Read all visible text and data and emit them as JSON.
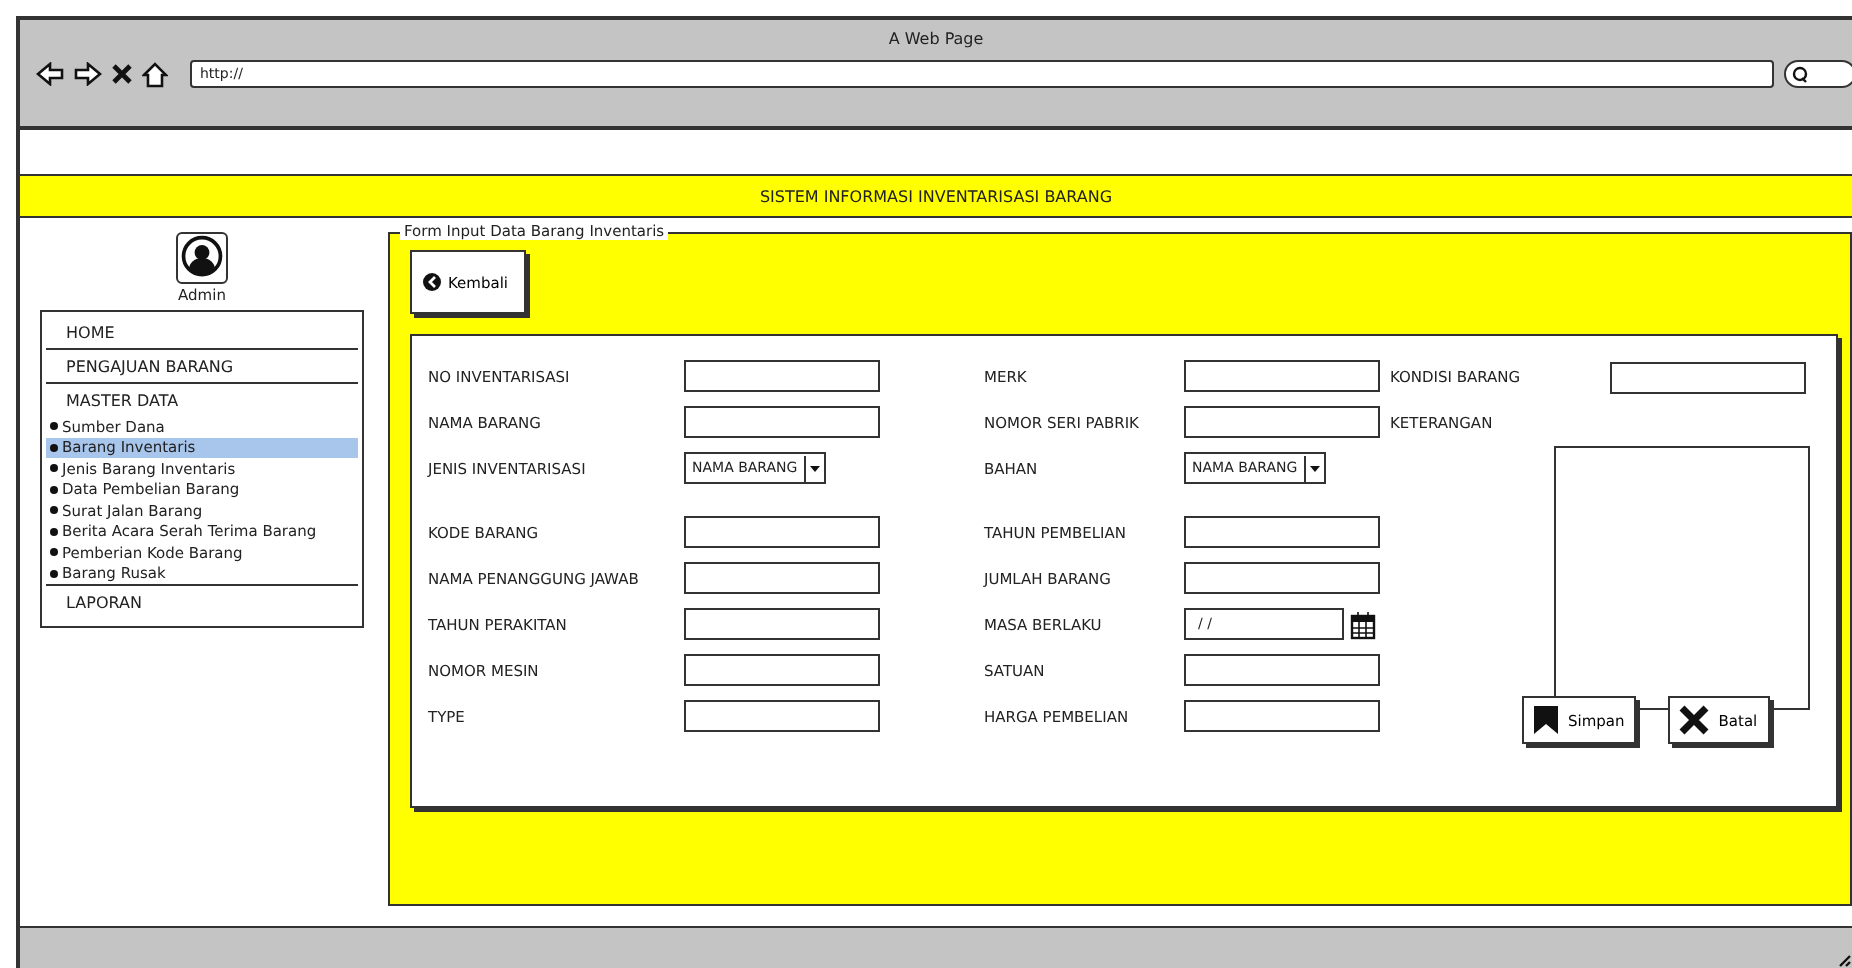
{
  "browser": {
    "title": "A Web Page",
    "url": "http://"
  },
  "header": {
    "title": "SISTEM INFORMASI INVENTARISASI BARANG"
  },
  "sidebar": {
    "user": "Admin",
    "menu": [
      {
        "label": "HOME",
        "kind": "section",
        "selected": false
      },
      {
        "label": "PENGAJUAN BARANG",
        "kind": "section",
        "selected": false
      },
      {
        "label": "MASTER DATA",
        "kind": "section",
        "selected": false
      },
      {
        "label": "Sumber Dana",
        "kind": "sub",
        "selected": false
      },
      {
        "label": "Barang Inventaris",
        "kind": "sub",
        "selected": true
      },
      {
        "label": "Jenis Barang Inventaris",
        "kind": "sub",
        "selected": false
      },
      {
        "label": "Data Pembelian Barang",
        "kind": "sub",
        "selected": false
      },
      {
        "label": "Surat Jalan Barang",
        "kind": "sub",
        "selected": false
      },
      {
        "label": "Berita Acara Serah Terima Barang",
        "kind": "sub",
        "selected": false
      },
      {
        "label": "Pemberian Kode Barang",
        "kind": "sub",
        "selected": false
      },
      {
        "label": "Barang Rusak",
        "kind": "sub",
        "selected": false
      },
      {
        "label": "LAPORAN",
        "kind": "section",
        "selected": false
      }
    ]
  },
  "form": {
    "legend": "Form Input Data Barang Inventaris",
    "back_button": "Kembali",
    "columns": [
      {
        "groups": [
          [
            {
              "label": "NO INVENTARISASI",
              "kind": "text"
            },
            {
              "label": "NAMA BARANG",
              "kind": "text"
            },
            {
              "label": "JENIS INVENTARISASI",
              "kind": "dropdown",
              "value": "NAMA BARANG"
            }
          ],
          [
            {
              "label": "KODE BARANG",
              "kind": "text"
            },
            {
              "label": "NAMA PENANGGUNG JAWAB",
              "kind": "text"
            },
            {
              "label": "TAHUN PERAKITAN",
              "kind": "text"
            },
            {
              "label": "NOMOR MESIN",
              "kind": "text"
            },
            {
              "label": "TYPE",
              "kind": "text"
            }
          ]
        ]
      },
      {
        "groups": [
          [
            {
              "label": "MERK",
              "kind": "text"
            },
            {
              "label": "NOMOR SERI PABRIK",
              "kind": "text"
            },
            {
              "label": "BAHAN",
              "kind": "dropdown",
              "value": "NAMA BARANG"
            }
          ],
          [
            {
              "label": "TAHUN PEMBELIAN",
              "kind": "text"
            },
            {
              "label": "JUMLAH BARANG",
              "kind": "text"
            },
            {
              "label": "MASA BERLAKU",
              "kind": "date",
              "value": "/ /"
            },
            {
              "label": "SATUAN",
              "kind": "text"
            },
            {
              "label": "HARGA PEMBELIAN",
              "kind": "text"
            }
          ]
        ]
      },
      {
        "groups": [
          [
            {
              "label": "KONDISI BARANG",
              "kind": "text"
            },
            {
              "label": "KETERANGAN",
              "kind": "textarea"
            }
          ]
        ]
      }
    ],
    "buttons": [
      {
        "label": "Simpan",
        "kind": "save"
      },
      {
        "label": "Batal",
        "kind": "cancel"
      }
    ]
  }
}
